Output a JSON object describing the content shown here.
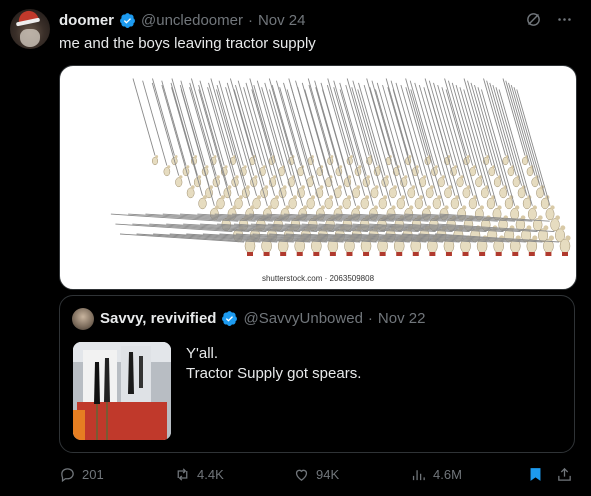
{
  "tweet": {
    "author_name": "doomer",
    "handle": "@uncledoomer",
    "separator": "·",
    "date": "Nov 24",
    "text": "me and the boys leaving tractor supply",
    "image_caption": "shutterstock.com · 2063509808"
  },
  "quote": {
    "author_name": "Savvy, revivified",
    "handle": "@SavvyUnbowed",
    "separator": "·",
    "date": "Nov 22",
    "line1": "Y'all.",
    "line2": "Tractor Supply got spears."
  },
  "actions": {
    "replies": "201",
    "reposts": "4.4K",
    "likes": "94K",
    "views": "4.6M"
  },
  "colors": {
    "background": "#000000",
    "text": "#e7e9ea",
    "muted": "#71767b",
    "accent": "#1d9bf0",
    "border": "#2f3336"
  },
  "icons": [
    "grok-icon",
    "more-icon",
    "verified-badge-icon",
    "reply-icon",
    "repost-icon",
    "like-icon",
    "views-icon",
    "bookmark-icon",
    "share-icon"
  ]
}
